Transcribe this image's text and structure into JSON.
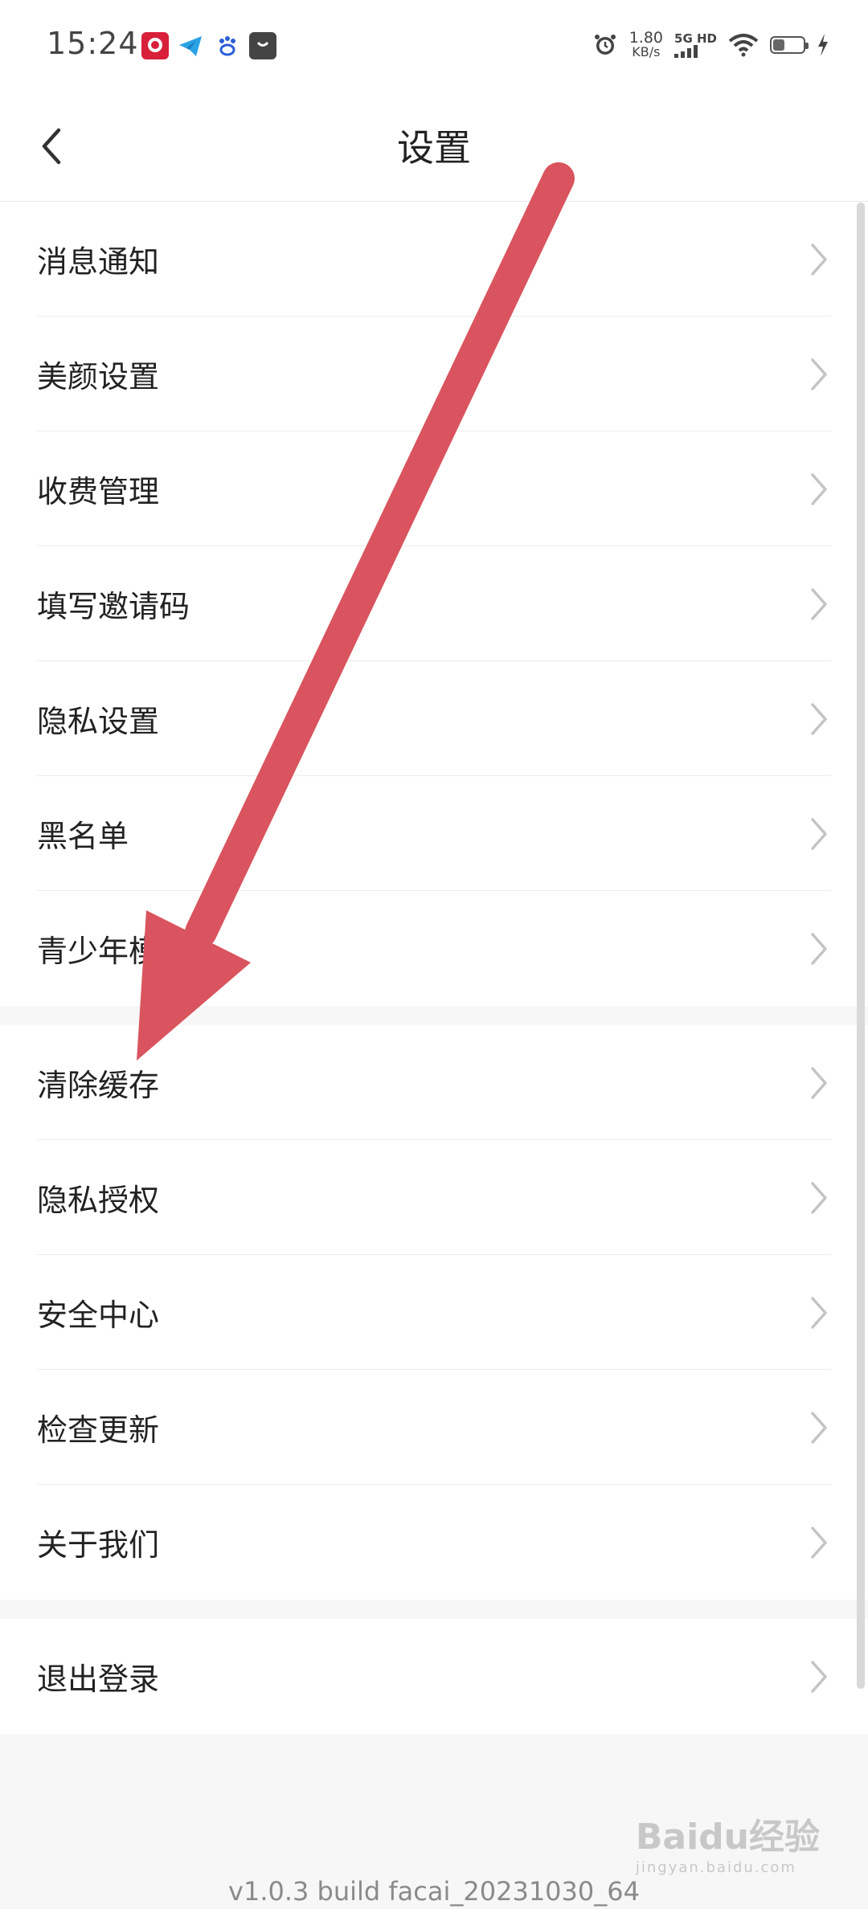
{
  "status_bar": {
    "time": "15:24",
    "speed_value": "1.80",
    "speed_unit": "KB/s",
    "network": "5G HD",
    "icons": [
      "alarm-icon",
      "signal-icon",
      "wifi-icon",
      "battery-icon",
      "charging-icon"
    ],
    "app_icons": [
      "app-red-icon",
      "app-telegram-icon",
      "app-baidu-icon",
      "app-bag-icon"
    ]
  },
  "header": {
    "title": "设置"
  },
  "groups": [
    {
      "items": [
        "消息通知",
        "美颜设置",
        "收费管理",
        "填写邀请码",
        "隐私设置",
        "黑名单",
        "青少年模式"
      ]
    },
    {
      "items": [
        "清除缓存",
        "隐私授权",
        "安全中心",
        "检查更新",
        "关于我们"
      ]
    },
    {
      "items": [
        "退出登录"
      ]
    }
  ],
  "footer": {
    "version": "v1.0.3 build facai_20231030_64"
  },
  "watermark": {
    "brand": "Baidu经验",
    "url": "jingyan.baidu.com"
  },
  "colors": {
    "arrow": "#d9545e",
    "background": "#f7f7f8",
    "chevron": "#c4c4c4"
  }
}
